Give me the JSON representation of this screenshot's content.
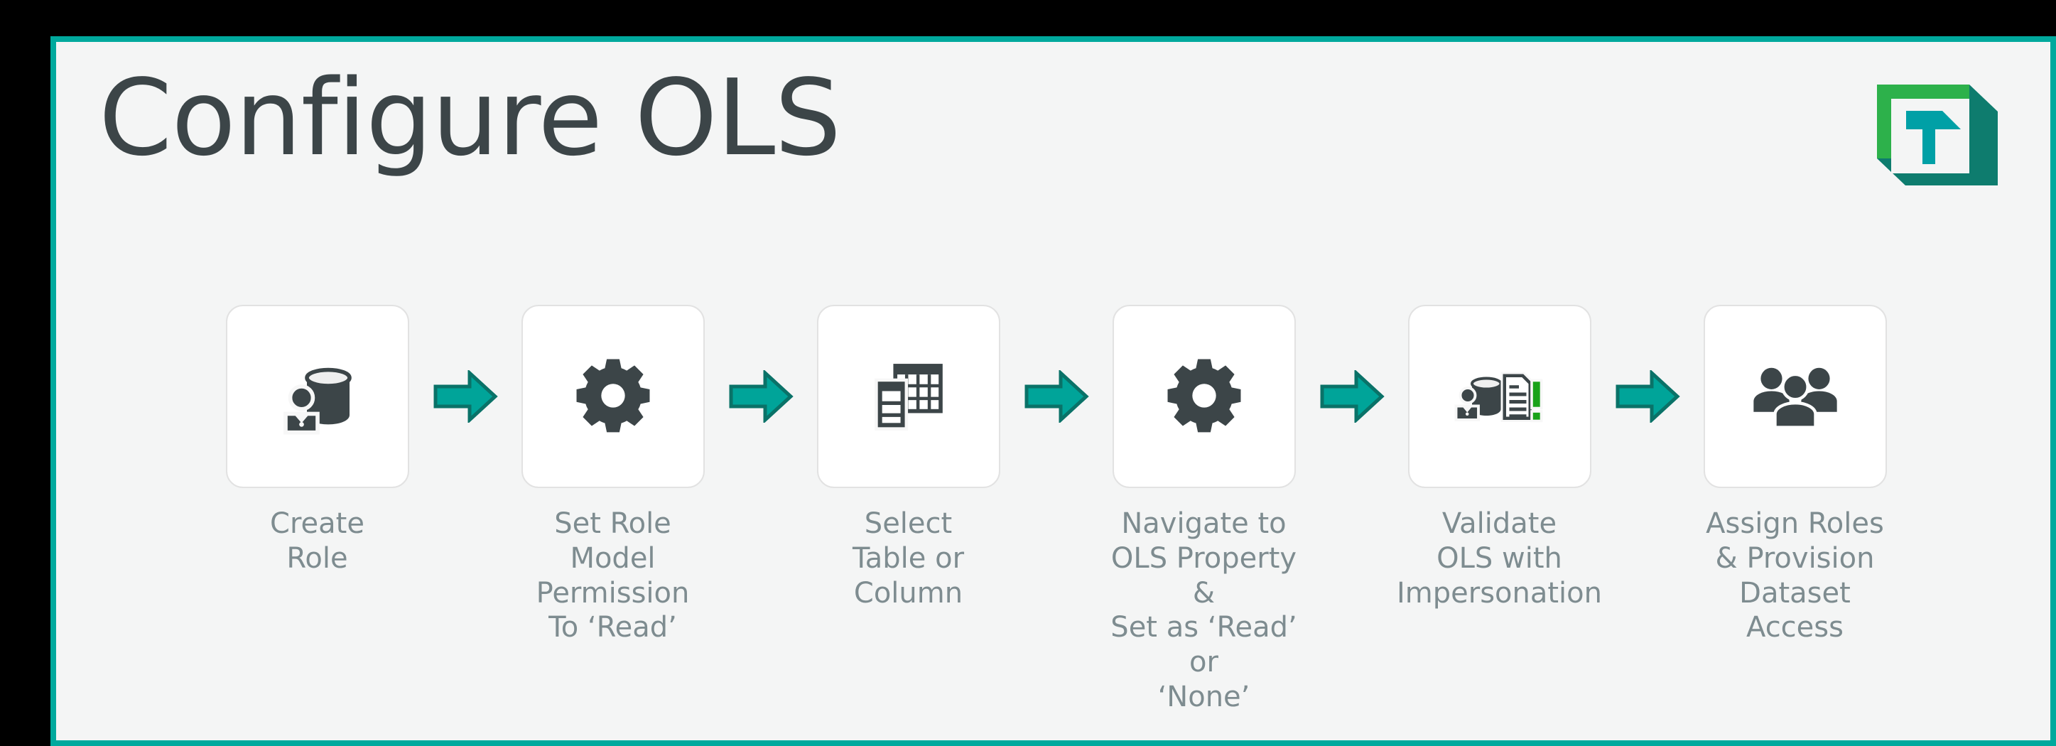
{
  "slide": {
    "title": "Configure OLS",
    "background_color": "#F4F5F5",
    "border_color": "#00A99D",
    "title_color": "#3C4548",
    "label_color": "#7E8C90",
    "outside_color": "#000000"
  },
  "logo": {
    "name": "brand-cube-logo",
    "front_color": "#2DB14B",
    "shadow_color": "#0E7C6E",
    "glyph_color": "#00A0A6",
    "face_color": "#F4F5F5",
    "letter": "T"
  },
  "arrow": {
    "name": "right-arrow",
    "fill": "#00A499",
    "stroke": "#0A7268"
  },
  "flow": {
    "steps": [
      {
        "icon": "database-user-icon",
        "label": "Create\nRole"
      },
      {
        "icon": "gear-icon",
        "label": "Set Role\nModel Permission\nTo ‘Read’"
      },
      {
        "icon": "table-column-icon",
        "label": "Select\nTable or\nColumn"
      },
      {
        "icon": "gear-icon",
        "label": "Navigate to\nOLS Property &\nSet as ‘Read’ or\n‘None’"
      },
      {
        "icon": "database-user-document-alert-icon",
        "label": "Validate\nOLS with\nImpersonation"
      },
      {
        "icon": "users-group-icon",
        "label": "Assign Roles\n& Provision\nDataset\nAccess"
      }
    ],
    "arrow_count": 5,
    "icon_color": "#3C4548",
    "alert_color": "#19A219",
    "card_background": "#FFFFFF",
    "card_border": "#E2E2E2"
  }
}
